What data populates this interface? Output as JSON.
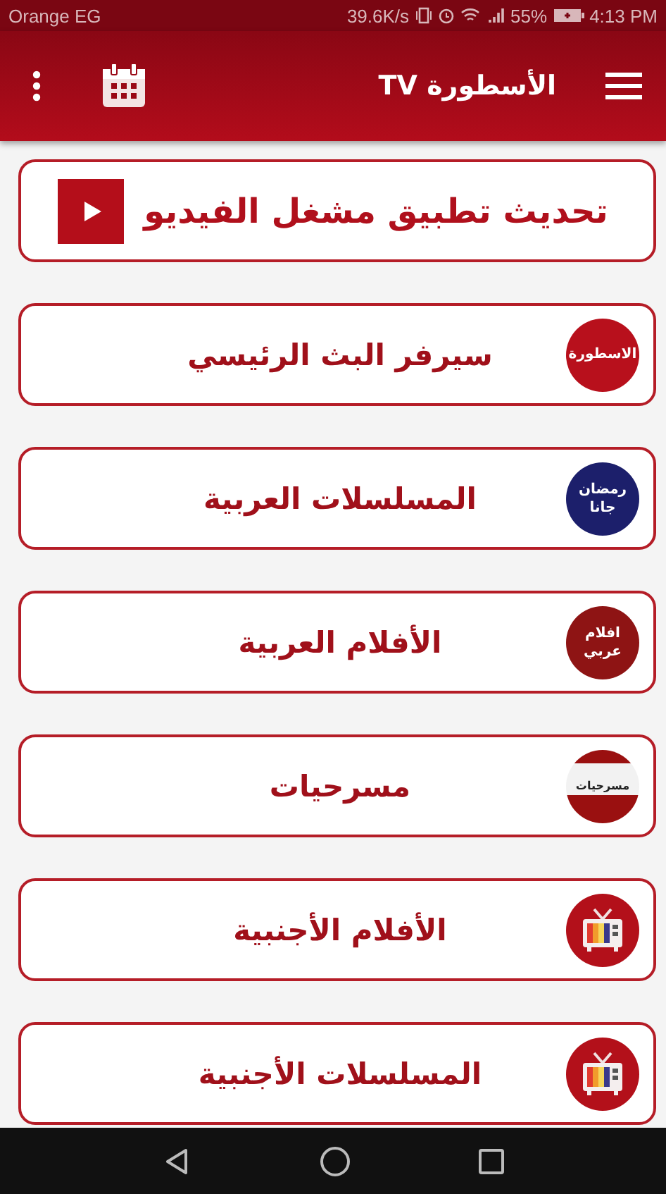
{
  "status_bar": {
    "carrier": "Orange EG",
    "speed": "39.6K/s",
    "battery": "55%",
    "time": "4:13 PM"
  },
  "toolbar": {
    "title": "الأسطورة TV"
  },
  "update_banner": {
    "label": "تحديث تطبيق مشغل الفيديو"
  },
  "items": [
    {
      "label": "سيرفر البث الرئيسي",
      "icon": {
        "kind": "badge",
        "text": "الاسطورة",
        "color": "#b8101c"
      }
    },
    {
      "label": "المسلسلات العربية",
      "icon": {
        "kind": "badge",
        "text": "رمضان جانا",
        "color": "#1c1f6b"
      }
    },
    {
      "label": "الأفلام العربية",
      "icon": {
        "kind": "badge",
        "text": "افلام عربي",
        "color": "#8e1414"
      }
    },
    {
      "label": "مسرحيات",
      "icon": {
        "kind": "stage",
        "text": "مسرحيات",
        "color": "#9a1010"
      }
    },
    {
      "label": "الأفلام الأجنبية",
      "icon": {
        "kind": "tv"
      }
    },
    {
      "label": "المسلسلات الأجنبية",
      "icon": {
        "kind": "tv"
      }
    }
  ]
}
